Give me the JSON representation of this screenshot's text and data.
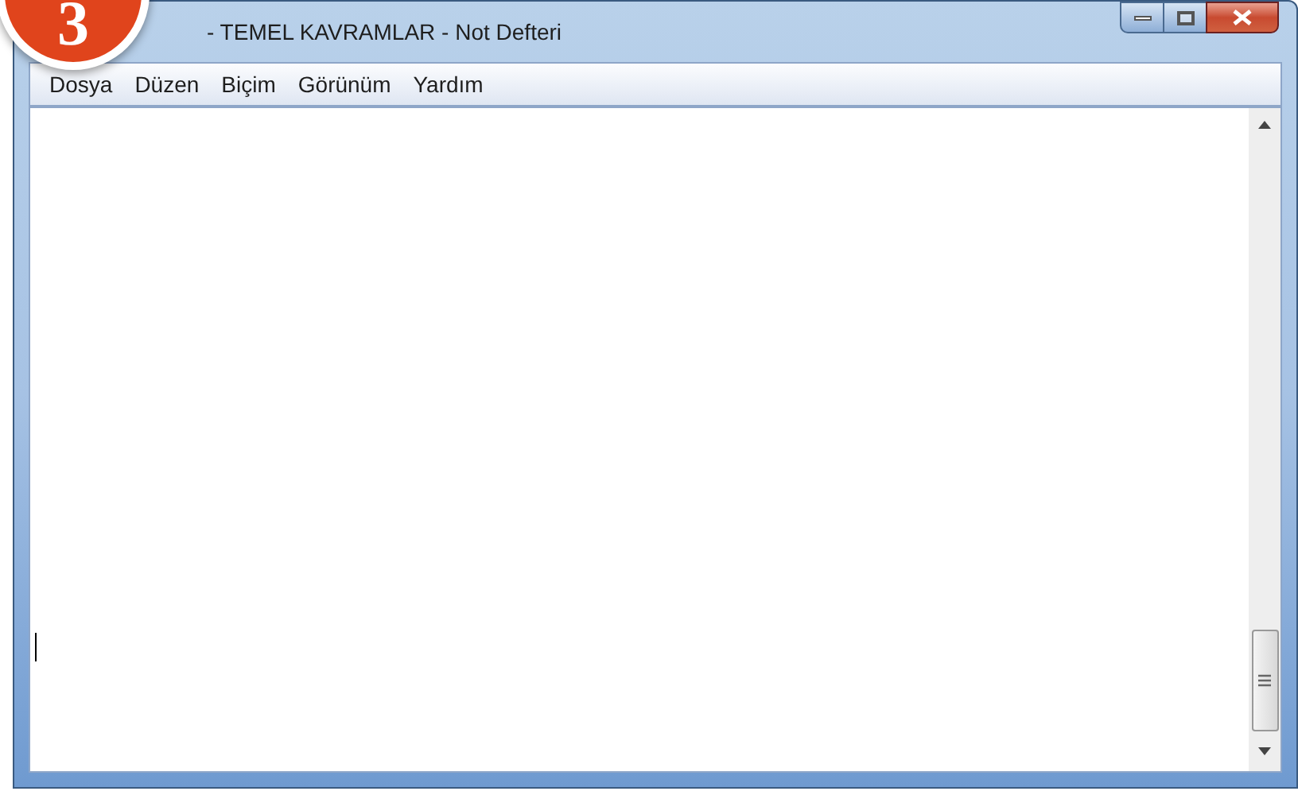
{
  "badge": {
    "label": "3"
  },
  "window": {
    "title": "- TEMEL KAVRAMLAR - Not Defteri"
  },
  "menu": [
    {
      "label": "Dosya"
    },
    {
      "label": "Düzen"
    },
    {
      "label": "Biçim"
    },
    {
      "label": "Görünüm"
    },
    {
      "label": "Yardım"
    }
  ],
  "editor": {
    "caret": true
  }
}
